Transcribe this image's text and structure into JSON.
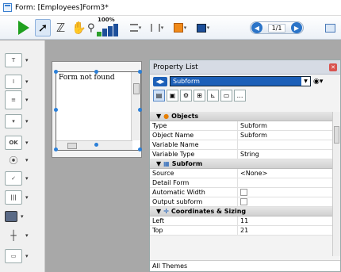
{
  "window": {
    "title": "Form: [Employees]Form3*"
  },
  "toolbar": {
    "zoom_level": "100%",
    "page_counter": "1/1"
  },
  "subform_preview": {
    "text": "Form not found"
  },
  "property_list": {
    "title": "Property List",
    "selected_object": "Subform",
    "footer": "All Themes",
    "categories": [
      {
        "name": "Objects",
        "rows": [
          {
            "key": "Type",
            "value": "Subform"
          },
          {
            "key": "Object Name",
            "value": "Subform"
          },
          {
            "key": "Variable Name",
            "value": ""
          },
          {
            "key": "Variable Type",
            "value": "String"
          }
        ]
      },
      {
        "name": "Subform",
        "rows": [
          {
            "key": "Source",
            "value": "<None>"
          },
          {
            "key": "Detail Form",
            "value": ""
          },
          {
            "key": "Automatic Width",
            "value": ""
          },
          {
            "key": "Output subform",
            "value": ""
          }
        ]
      },
      {
        "name": "Coordinates & Sizing",
        "rows": [
          {
            "key": "Left",
            "value": "11"
          },
          {
            "key": "Top",
            "value": "21"
          }
        ]
      }
    ]
  }
}
